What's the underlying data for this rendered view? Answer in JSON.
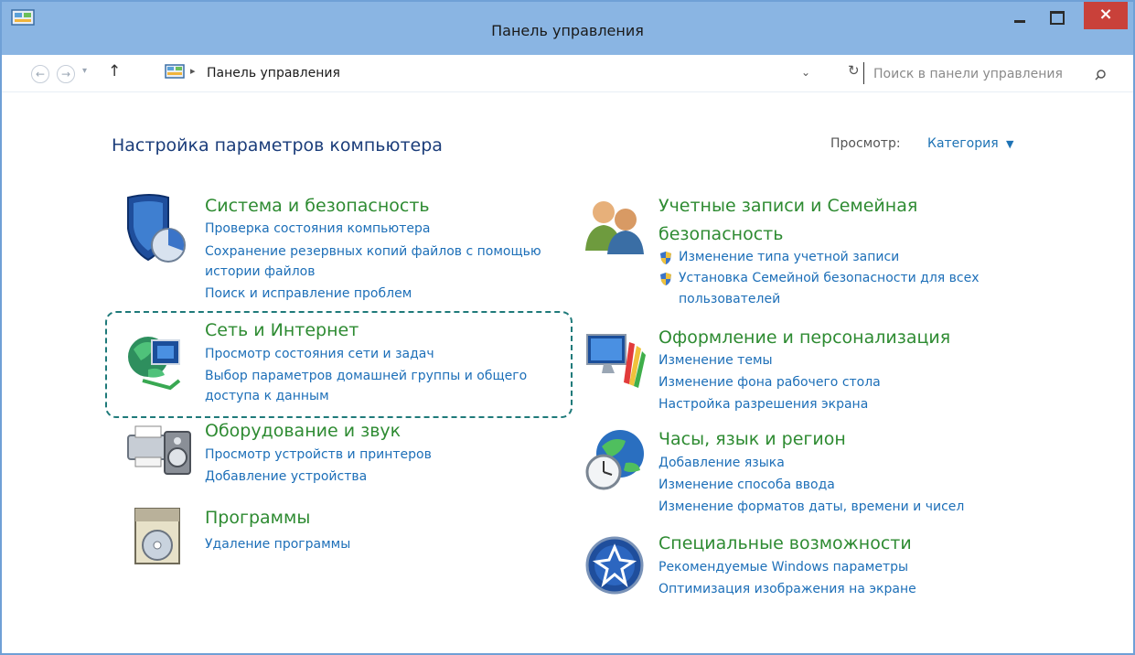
{
  "window": {
    "title": "Панель управления",
    "close_label": "×"
  },
  "navbar": {
    "back_icon": "back-arrow-icon",
    "forward_icon": "forward-arrow-icon",
    "up_icon": "up-arrow-icon",
    "up_glyph": "↑",
    "back_glyph": "←",
    "forward_glyph": "→",
    "dropdown_glyph": "▾",
    "address_separator": "▸",
    "address_text": "Панель управления",
    "address_dropdown": "⌄",
    "refresh_glyph": "↻",
    "search_placeholder": "Поиск в панели управления"
  },
  "main": {
    "heading": "Настройка параметров компьютера",
    "view_label": "Просмотр:",
    "view_value": "Категория",
    "view_arrow": "▼"
  },
  "categories": {
    "system": {
      "title": "Система и безопасность",
      "links": [
        "Проверка состояния компьютера",
        "Сохранение резервных копий файлов с помощью",
        "истории файлов",
        "Поиск и исправление проблем"
      ]
    },
    "network": {
      "title": "Сеть и Интернет",
      "links": [
        "Просмотр состояния сети и задач",
        "Выбор параметров домашней группы и общего",
        "доступа к данным"
      ]
    },
    "hardware": {
      "title": "Оборудование и звук",
      "links": [
        "Просмотр устройств и принтеров",
        "Добавление устройства"
      ]
    },
    "programs": {
      "title": "Программы",
      "links": [
        "Удаление программы"
      ]
    },
    "accounts": {
      "title_line1": "Учетные записи и Семейная",
      "title_line2": "безопасность",
      "links": [
        "Изменение типа учетной записи",
        "Установка Семейной безопасности для всех",
        "пользователей"
      ]
    },
    "appearance": {
      "title": "Оформление и персонализация",
      "links": [
        "Изменение темы",
        "Изменение фона рабочего стола",
        "Настройка разрешения экрана"
      ]
    },
    "clock": {
      "title": "Часы, язык и регион",
      "links": [
        "Добавление языка",
        "Изменение способа ввода",
        "Изменение форматов даты, времени и чисел"
      ]
    },
    "access": {
      "title": "Специальные возможности",
      "links": [
        "Рекомендуемые Windows параметры",
        "Оптимизация изображения на экране"
      ]
    }
  },
  "colors": {
    "titlebar": "#8ab5e3",
    "close": "#c9413a",
    "category_title": "#2e8b32",
    "link": "#1d6fb8",
    "heading": "#1b3d7a",
    "highlight_border": "#1f7a7a"
  }
}
